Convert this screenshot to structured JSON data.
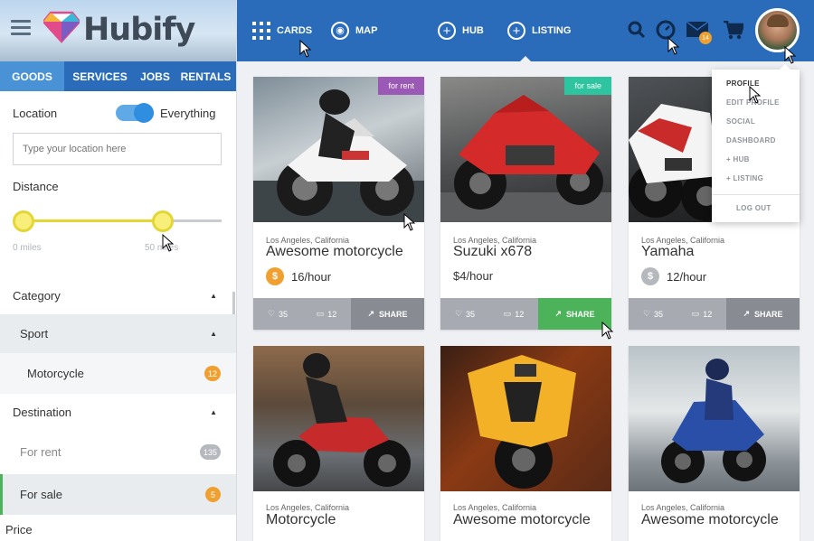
{
  "brand": {
    "name": "Hubify"
  },
  "category_tabs": [
    {
      "label": "GOODS",
      "active": true
    },
    {
      "label": "SERVICES",
      "active": false
    },
    {
      "label": "JOBS",
      "active": false
    },
    {
      "label": "RENTALS",
      "active": false
    }
  ],
  "filters": {
    "location_label": "Location",
    "everything_label": "Everything",
    "everything_on": true,
    "location_placeholder": "Type your location here",
    "distance_label": "Distance",
    "distance_min": "0 miles",
    "distance_max": "50 miles",
    "distance_value_fraction": 0.7,
    "category_label": "Category",
    "sport_label": "Sport",
    "motorcycle_label": "Motorcycle",
    "motorcycle_count": "12",
    "destination_label": "Destination",
    "for_rent_label": "For rent",
    "for_rent_count": "135",
    "for_sale_label": "For sale",
    "for_sale_count": "5",
    "price_label": "Price"
  },
  "nav": {
    "cards": "CARDS",
    "map": "MAP",
    "hub": "HUB",
    "listing": "LISTING",
    "messages_badge": "14"
  },
  "profile_menu": [
    "PROFILE",
    "EDIT PROFILE",
    "SOCIAL",
    "DASHBOARD",
    "+ HUB",
    "+ LISTING"
  ],
  "logout": "LOG OUT",
  "cards": [
    {
      "location": "Los Angeles, California",
      "title": "Awesome motorcycle",
      "price": "16/hour",
      "ribbon": "for rent",
      "likes": "35",
      "comments": "12",
      "share": "SHARE"
    },
    {
      "location": "Los Angeles, California",
      "title": "Suzuki x678",
      "price": "$4/hour",
      "ribbon": "for sale",
      "likes": "35",
      "comments": "12",
      "share": "SHARE"
    },
    {
      "location": "Los Angeles, California",
      "title": "Yamaha",
      "price": "12/hour",
      "likes": "35",
      "comments": "12",
      "share": "SHARE"
    },
    {
      "location": "Los Angeles, California",
      "title": "Motorcycle"
    },
    {
      "location": "Los Angeles, California",
      "title": "Awesome motorcycle"
    },
    {
      "location": "Los Angeles, California",
      "title": "Awesome motorcycle"
    }
  ],
  "colors": {
    "primary": "#2a6cba",
    "tab_active": "#4a92d6",
    "accent_green": "#4cb35a",
    "badge_orange": "#f0a030",
    "rent_purple": "#9b59b6",
    "sale_teal": "#2ec4a0",
    "slider_yellow": "#e3d635"
  }
}
